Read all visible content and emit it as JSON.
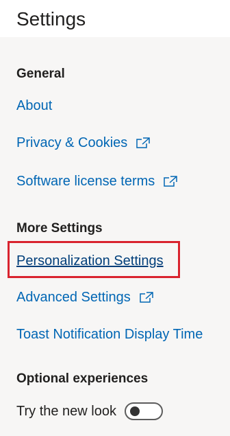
{
  "header": {
    "title": "Settings"
  },
  "sections": {
    "general": {
      "heading": "General",
      "about": "About",
      "privacy": "Privacy & Cookies",
      "license": "Software license terms"
    },
    "more": {
      "heading": "More Settings",
      "personalization": "Personalization Settings",
      "advanced": "Advanced Settings",
      "toast": "Toast Notification Display Time"
    },
    "optional": {
      "heading": "Optional experiences",
      "new_look_label": "Try the new look",
      "new_look_enabled": false
    }
  },
  "icons": {
    "external": "external-link-icon"
  },
  "colors": {
    "link": "#0066b4",
    "highlight": "#d9232e",
    "panel_bg": "#f7f6f5"
  }
}
